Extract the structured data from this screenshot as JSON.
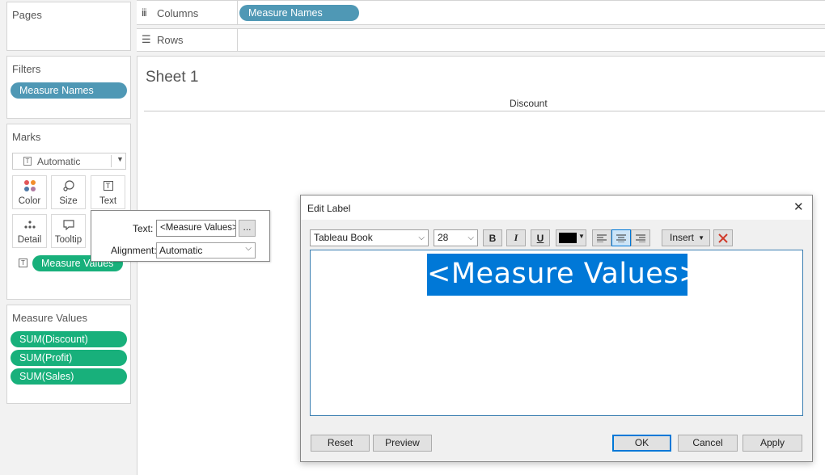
{
  "sidebar": {
    "pages": {
      "title": "Pages"
    },
    "filters": {
      "title": "Filters",
      "pill": "Measure Names"
    },
    "marks": {
      "title": "Marks",
      "type_select": "Automatic",
      "buttons": [
        "Color",
        "Size",
        "Text",
        "Detail",
        "Tooltip"
      ],
      "text_pill": "Measure Values"
    },
    "measure_values": {
      "title": "Measure Values",
      "pills": [
        "SUM(Discount)",
        "SUM(Profit)",
        "SUM(Sales)"
      ]
    }
  },
  "shelves": {
    "columns_label": "Columns",
    "columns_pill": "Measure Names",
    "rows_label": "Rows"
  },
  "sheet": {
    "title": "Sheet 1",
    "column_header": "Discount"
  },
  "text_popup": {
    "text_label": "Text:",
    "text_value": "<Measure Values>",
    "more_button": "...",
    "alignment_label": "Alignment:",
    "alignment_value": "Automatic"
  },
  "dialog": {
    "title": "Edit Label",
    "close": "✕",
    "font": "Tableau Book",
    "size": "28",
    "bold": "B",
    "italic": "I",
    "underline": "U",
    "text_color": "#000000",
    "insert_label": "Insert",
    "editor_text": "<Measure Values>",
    "buttons": {
      "reset": "Reset",
      "preview": "Preview",
      "ok": "OK",
      "cancel": "Cancel",
      "apply": "Apply"
    }
  },
  "colors": {
    "pill_blue": "#4f98b5",
    "pill_green": "#18b07b",
    "selection": "#0078d7",
    "accent": "#0078d7"
  }
}
